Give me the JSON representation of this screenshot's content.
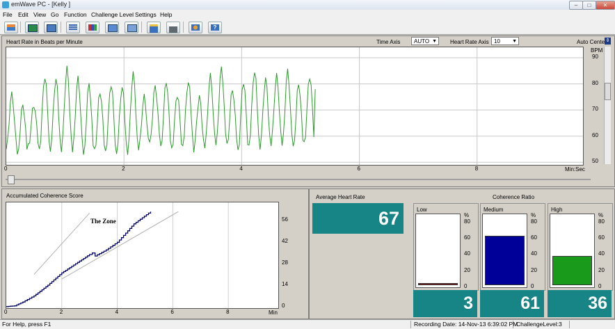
{
  "window": {
    "title": "emWave PC - [Kelly ]"
  },
  "menu": [
    "File",
    "Edit",
    "View",
    "Go",
    "Function",
    "Challenge Level",
    "Settings",
    "Help"
  ],
  "toolbar": [
    "home-icon",
    "session-icon",
    "wave-icon",
    "view-list-icon",
    "bar-chart-icon",
    "graph-icon",
    "line-graph-icon",
    "open-folder-icon",
    "print-icon",
    "coach-icon",
    "help-icon"
  ],
  "hr_panel": {
    "title": "Heart Rate in Beats per Minute",
    "time_axis_label": "Time Axis",
    "time_axis_value": "AUTO",
    "hr_axis_label": "Heart Rate Axis",
    "hr_axis_value": "10",
    "auto_center_label": "Auto Center",
    "bpm_label": "BPM",
    "x_unit": "Min:Sec"
  },
  "coherence_panel": {
    "title": "Accumulated Coherence Score",
    "zone_label": "The Zone",
    "x_unit": "Min"
  },
  "stats": {
    "avg_title": "Average Heart Rate",
    "avg_value": "67",
    "ratio_title": "Coherence Ratio",
    "low_label": "Low",
    "low_value": "3",
    "medium_label": "Medium",
    "medium_value": "61",
    "high_label": "High",
    "high_value": "36",
    "percent": "%"
  },
  "status": {
    "help": "For Help, press F1",
    "recording": "Recording Date: 14-Nov-13 6:39:02 PM",
    "level": "ChallengeLevel:3"
  },
  "colors": {
    "teal": "#178585",
    "low": "#7a1a1a",
    "medium": "#000099",
    "high": "#1a9a1a",
    "hr_line": "#2a9a2a",
    "coh_line": "#000066"
  },
  "chart_data": [
    {
      "type": "line",
      "title": "Heart Rate in Beats per Minute",
      "xlabel": "Min:Sec",
      "ylabel": "BPM",
      "xlim": [
        0,
        9.8
      ],
      "ylim": [
        49,
        94
      ],
      "x_ticks": [
        0,
        2,
        4,
        6,
        8
      ],
      "y_ticks": [
        50,
        60,
        70,
        80,
        90
      ],
      "series": [
        {
          "cycle_peaks": [
            76,
            72,
            72,
            83,
            82,
            86,
            82,
            80,
            77,
            80,
            79,
            84,
            75,
            79,
            81,
            76,
            81,
            75,
            83,
            86,
            78,
            81,
            85,
            82,
            83,
            85,
            80,
            83
          ],
          "cycle_troughs": [
            55,
            52,
            56,
            55,
            55,
            55,
            54,
            52,
            54,
            54,
            54,
            54,
            55,
            57,
            55,
            55,
            57,
            55,
            56,
            56,
            56,
            54,
            57,
            56,
            57,
            56,
            55,
            57
          ],
          "x_end": 5.25
        }
      ]
    },
    {
      "type": "line",
      "title": "Accumulated Coherence Score",
      "xlabel": "Min",
      "xlim": [
        0,
        9.8
      ],
      "ylim": [
        -1,
        68
      ],
      "x_ticks": [
        0,
        2,
        4,
        6,
        8
      ],
      "y_ticks": [
        0,
        14,
        28,
        42,
        56
      ],
      "series": [
        {
          "x": [
            0,
            0.3,
            0.6,
            1.0,
            1.5,
            2.0,
            2.5,
            3.0,
            3.1,
            3.2,
            3.6,
            4.0,
            4.3,
            4.6,
            4.9,
            5.2
          ],
          "y": [
            0,
            0.5,
            3,
            7,
            14,
            22,
            28,
            34,
            35,
            33,
            37,
            42,
            48,
            54,
            58,
            62
          ]
        }
      ],
      "zone_lines": [
        {
          "x": [
            1.0,
            3.0
          ],
          "y": [
            21,
            61
          ]
        },
        {
          "x": [
            2.0,
            6.2
          ],
          "y": [
            18,
            62
          ]
        }
      ]
    },
    {
      "type": "bar",
      "title": "Coherence Ratio",
      "categories": [
        "Low",
        "Medium",
        "High"
      ],
      "values": [
        3,
        61,
        36
      ],
      "ylim": [
        0,
        90
      ],
      "y_ticks": [
        0,
        20,
        40,
        60,
        80
      ]
    }
  ]
}
